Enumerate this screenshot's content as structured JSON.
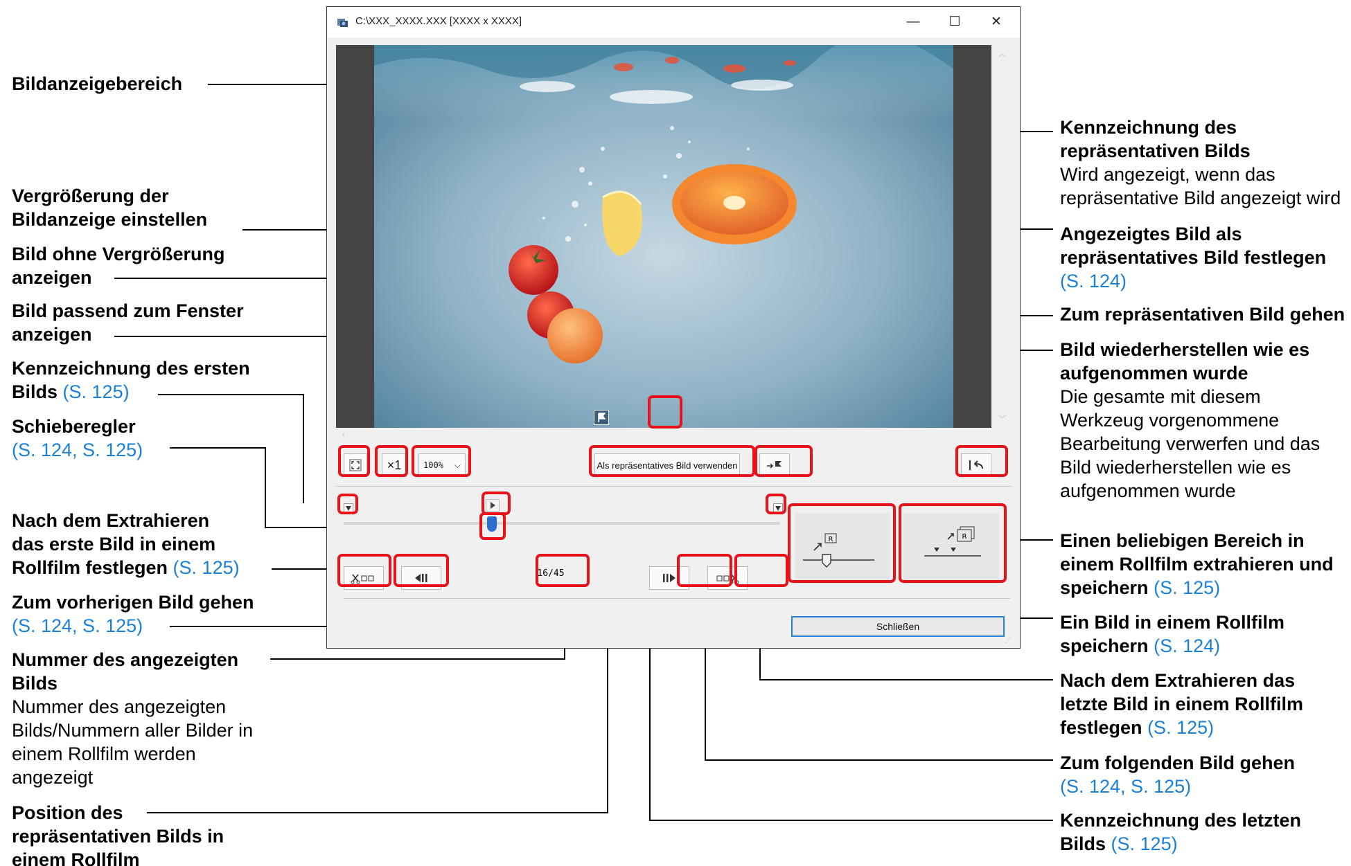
{
  "window": {
    "title": "C:\\XXX_XXXX.XXX [XXXX x XXXX]",
    "minimize_icon": "minimize-icon",
    "maximize_icon": "maximize-icon",
    "close_icon": "close-icon"
  },
  "toolbar": {
    "fit_icon": "fit-to-window-icon",
    "actual_size_label": "×1",
    "zoom_value": "100%",
    "set_representative_label": "Als repräsentatives Bild verwenden",
    "goto_representative_icon": "goto-representative-icon",
    "restore_icon": "restore-icon"
  },
  "timeline": {
    "frame_counter": "16/45",
    "close_label": "Schließen"
  },
  "callouts": {
    "display_area": {
      "title": "Bildanzeigebereich"
    },
    "zoom": {
      "line1": "Vergrößerung der",
      "line2": "Bildanzeige einstellen"
    },
    "no_zoom": {
      "line1": "Bild ohne Vergrößerung",
      "line2": "anzeigen"
    },
    "fit": {
      "line1": "Bild passend zum Fenster",
      "line2": "anzeigen"
    },
    "first_mark": {
      "line1": "Kennzeichnung des ersten",
      "line2": "Bilds",
      "ref": "(S. 125)"
    },
    "slider": {
      "title": "Schieberegler",
      "ref": "(S. 124, S. 125)"
    },
    "set_first": {
      "line1": "Nach dem Extrahieren",
      "line2": "das erste Bild in einem",
      "line3": "Rollfilm festlegen",
      "ref": "(S. 125)"
    },
    "prev": {
      "title": "Zum vorherigen Bild gehen",
      "ref": "(S. 124, S. 125)"
    },
    "number": {
      "line1": "Nummer des angezeigten",
      "line2": "Bilds",
      "desc1": "Nummer des angezeigten",
      "desc2": "Bilds/Nummern aller Bilder in",
      "desc3": "einem Rollfilm werden",
      "desc4": "angezeigt"
    },
    "rep_position": {
      "line1": "Position des",
      "line2": "repräsentativen Bilds in",
      "line3": "einem Rollfilm"
    },
    "rep_mark": {
      "line1": "Kennzeichnung des",
      "line2": "repräsentativen Bilds",
      "desc1": "Wird angezeigt, wenn das",
      "desc2": "repräsentative Bild angezeigt wird"
    },
    "set_rep": {
      "line1": "Angezeigtes Bild als",
      "line2": "repräsentatives Bild festlegen",
      "ref": "(S. 124)"
    },
    "goto_rep": {
      "title": "Zum repräsentativen Bild gehen"
    },
    "restore": {
      "line1": "Bild wiederherstellen wie es",
      "line2": "aufgenommen wurde",
      "desc1": "Die gesamte mit diesem",
      "desc2": "Werkzeug vorgenommene",
      "desc3": "Bearbeitung verwerfen und das",
      "desc4": "Bild wiederherstellen wie es",
      "desc5": "aufgenommen wurde"
    },
    "extract_range": {
      "line1": "Einen beliebigen Bereich in",
      "line2": "einem Rollfilm extrahieren und",
      "line3": "speichern",
      "ref": "(S. 125)"
    },
    "save_one": {
      "line1": "Ein Bild in einem Rollfilm",
      "line2": "speichern",
      "ref": "(S. 124)"
    },
    "set_last": {
      "line1": "Nach dem Extrahieren das",
      "line2": "letzte Bild in einem Rollfilm",
      "line3": "festlegen",
      "ref": "(S. 125)"
    },
    "next": {
      "title": "Zum folgenden Bild gehen",
      "ref": "(S. 124, S. 125)"
    },
    "last_mark": {
      "line1": "Kennzeichnung des letzten",
      "line2": "Bilds",
      "ref": "(S. 125)"
    }
  },
  "colors": {
    "highlight": "#e8121a",
    "reference": "#1a7fd6",
    "slider_thumb": "#2a6fd0"
  }
}
